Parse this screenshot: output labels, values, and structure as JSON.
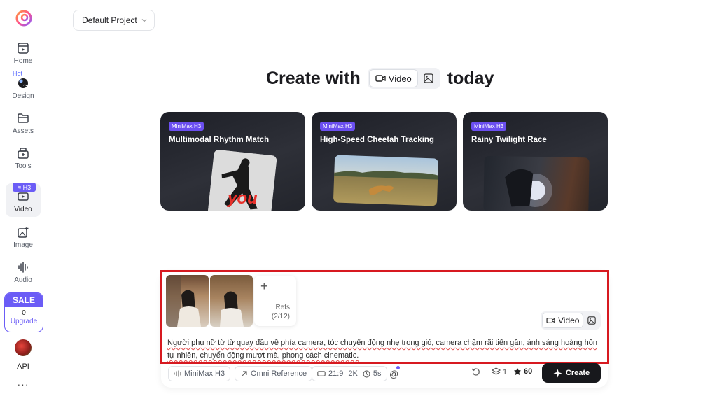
{
  "sidebar": {
    "items": [
      {
        "label": "Home",
        "icon": "home-icon"
      },
      {
        "label": "Design",
        "icon": "design-icon"
      },
      {
        "label": "Assets",
        "icon": "folder-icon"
      },
      {
        "label": "Tools",
        "icon": "tools-icon"
      },
      {
        "label": "Video",
        "icon": "video-icon"
      },
      {
        "label": "Image",
        "icon": "image-icon"
      },
      {
        "label": "Audio",
        "icon": "audio-icon"
      }
    ],
    "hot_tag": "Hot",
    "video_tag": "H3",
    "sale": {
      "title": "SALE",
      "count": "0",
      "upgrade": "Upgrade"
    },
    "api_label": "API",
    "more": "···"
  },
  "project": {
    "name": "Default Project"
  },
  "heading": {
    "prefix": "Create with",
    "video_label": "Video",
    "suffix": "today"
  },
  "cards": [
    {
      "badge": "MiniMax H3",
      "title": "Multimodal Rhythm Match"
    },
    {
      "badge": "MiniMax H3",
      "title": "High-Speed Cheetah Tracking"
    },
    {
      "badge": "MiniMax H3",
      "title": "Rainy Twilight Race"
    }
  ],
  "card_overlay_text": "you",
  "composer": {
    "refs_label": "Refs",
    "refs_count": "(2/12)",
    "plus": "+",
    "mode_video": "Video",
    "prompt": "Người phụ nữ từ từ quay đầu về phía camera, tóc chuyển động nhẹ trong gió, camera chậm rãi tiến gần, ánh sáng hoàng hôn tự nhiên, chuyển động mượt mà, phong cách cinematic."
  },
  "toolbar": {
    "model": "MiniMax H3",
    "reference": "Omni Reference",
    "ratio": "21:9",
    "resolution": "2K",
    "duration": "5s",
    "mention": "@",
    "count": "1",
    "credits": "60",
    "create_label": "Create"
  },
  "colors": {
    "accent": "#6b5cf6",
    "highlight_frame": "#d71920",
    "create_button": "#17181c"
  }
}
